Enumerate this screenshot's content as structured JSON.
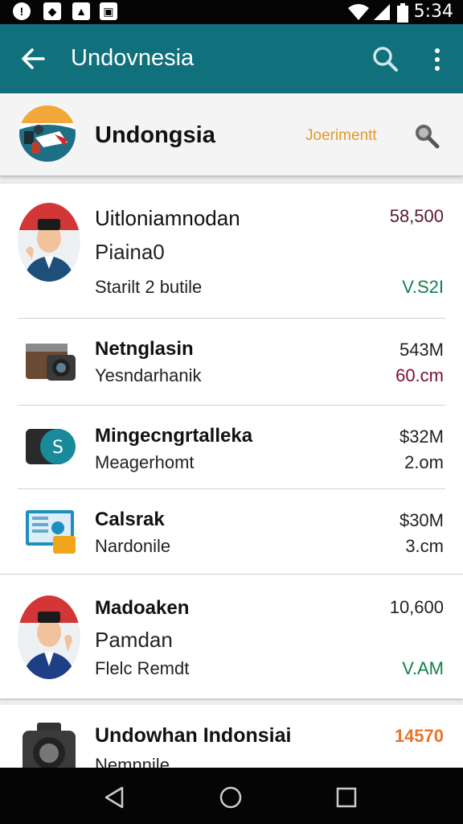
{
  "status_bar": {
    "icons": [
      "notification-icon",
      "shield-icon",
      "image-icon",
      "gallery-icon",
      "wifi-icon",
      "signal-icon",
      "battery-icon"
    ],
    "time": "5:34"
  },
  "app_bar": {
    "title": "Undovnesia",
    "icons": [
      "back-arrow-icon",
      "search-icon",
      "more-vert-icon"
    ]
  },
  "header": {
    "title": "Undongsia",
    "link": "Joerimentt",
    "icons": [
      "flag-logo-icon",
      "magnifier-icon"
    ]
  },
  "items": [
    {
      "title": "Uitloniamnodan",
      "subtitle": "Piaina0",
      "meta": "Starilt 2 butile",
      "value": "58,500",
      "value2": "V.S2I",
      "icon": "person-avatar-icon"
    },
    {
      "title": "Netnglasin",
      "subtitle": "Yesndarhanik",
      "value": "543M",
      "value2": "60.cm",
      "icon": "camera-icon"
    },
    {
      "title": "Mingecngrtalleka",
      "subtitle": "Meagerhomt",
      "value": "$32M",
      "value2": "2.om",
      "icon": "wallet-icon"
    },
    {
      "title": "Calsrak",
      "subtitle": "Nardonile",
      "value": "$30M",
      "value2": "3.cm",
      "icon": "dashboard-icon"
    },
    {
      "title": "Madoaken",
      "subtitle": "Pamdan",
      "meta": "Flelc Remdt",
      "value": "10,600",
      "value2": "V.AM",
      "icon": "person-avatar-icon"
    },
    {
      "title": "Undowhan Indonsiai",
      "subtitle": "Nemnnile",
      "value": "14570",
      "icon": "camera-icon"
    }
  ],
  "colors": {
    "appbar": "#10707c",
    "accent_orange": "#e8752a",
    "accent_green": "#12804a",
    "accent_maroon": "#7a1030"
  },
  "nav_bar": {
    "icons": [
      "back-triangle-icon",
      "home-circle-icon",
      "recents-square-icon"
    ]
  }
}
